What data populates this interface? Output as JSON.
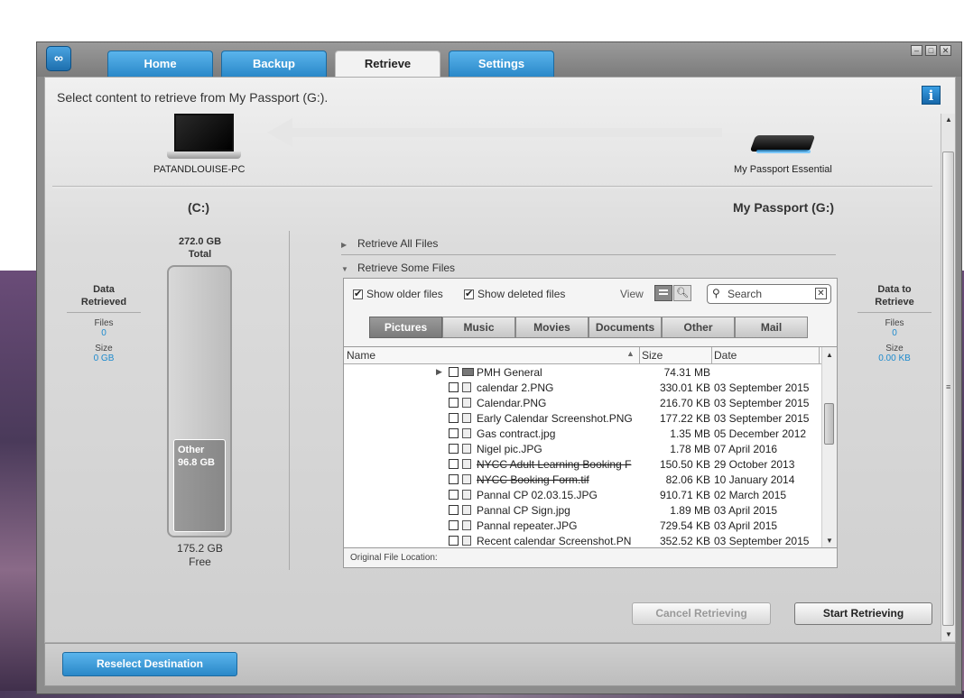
{
  "tabs": [
    {
      "label": "Home",
      "active": false
    },
    {
      "label": "Backup",
      "active": false
    },
    {
      "label": "Retrieve",
      "active": true
    },
    {
      "label": "Settings",
      "active": false
    }
  ],
  "prompt": "Select content to retrieve from My Passport (G:).",
  "source_device": {
    "name": "PATANDLOUISE-PC",
    "drive_label": "(C:)"
  },
  "dest_device": {
    "name": "My Passport Essential",
    "drive_label": "My Passport (G:)"
  },
  "capacity": {
    "total_value": "272.0 GB",
    "total_word": "Total",
    "other_label": "Other",
    "other_value": "96.8  GB",
    "other_fraction": 0.356,
    "free_value": "175.2 GB",
    "free_word": "Free"
  },
  "left_stats": {
    "head1": "Data",
    "head2": "Retrieved",
    "files_label": "Files",
    "files_value": "0",
    "size_label": "Size",
    "size_value": "0 GB"
  },
  "right_stats": {
    "head1": "Data to",
    "head2": "Retrieve",
    "files_label": "Files",
    "files_value": "0",
    "size_label": "Size",
    "size_value": "0.00 KB"
  },
  "retrieve_all": "Retrieve All Files",
  "retrieve_some": "Retrieve Some Files",
  "options": {
    "show_older": "Show older files",
    "show_deleted": "Show deleted files",
    "view_label": "View",
    "search_placeholder": "Search"
  },
  "categories": [
    {
      "label": "Pictures",
      "active": true
    },
    {
      "label": "Music",
      "active": false
    },
    {
      "label": "Movies",
      "active": false
    },
    {
      "label": "Documents",
      "active": false
    },
    {
      "label": "Other",
      "active": false
    },
    {
      "label": "Mail",
      "active": false
    }
  ],
  "columns": {
    "name": "Name",
    "size": "Size",
    "date": "Date"
  },
  "files": [
    {
      "name": "PMH General",
      "size": "74.31 MB",
      "date": "",
      "folder": true,
      "deleted": false
    },
    {
      "name": "calendar 2.PNG",
      "size": "330.01 KB",
      "date": "03 September 2015",
      "folder": false,
      "deleted": false
    },
    {
      "name": "Calendar.PNG",
      "size": "216.70 KB",
      "date": "03 September 2015",
      "folder": false,
      "deleted": false
    },
    {
      "name": "Early Calendar Screenshot.PNG",
      "size": "177.22 KB",
      "date": "03 September 2015",
      "folder": false,
      "deleted": false
    },
    {
      "name": "Gas contract.jpg",
      "size": "1.35 MB",
      "date": "05 December 2012",
      "folder": false,
      "deleted": false
    },
    {
      "name": "Nigel pic.JPG",
      "size": "1.78 MB",
      "date": "07 April 2016",
      "folder": false,
      "deleted": false
    },
    {
      "name": "NYCC Adult Learning Booking F",
      "size": "150.50 KB",
      "date": "29 October 2013",
      "folder": false,
      "deleted": true
    },
    {
      "name": "NYCC Booking Form.tif",
      "size": "82.06 KB",
      "date": "10 January 2014",
      "folder": false,
      "deleted": true
    },
    {
      "name": "Pannal CP 02.03.15.JPG",
      "size": "910.71 KB",
      "date": "02 March 2015",
      "folder": false,
      "deleted": false
    },
    {
      "name": "Pannal CP Sign.jpg",
      "size": "1.89 MB",
      "date": "03 April 2015",
      "folder": false,
      "deleted": false
    },
    {
      "name": "Pannal repeater.JPG",
      "size": "729.54 KB",
      "date": "03 April 2015",
      "folder": false,
      "deleted": false
    },
    {
      "name": "Recent calendar Screenshot.PN",
      "size": "352.52 KB",
      "date": "03 September 2015",
      "folder": false,
      "deleted": false
    }
  ],
  "original_location_label": "Original File Location:",
  "buttons": {
    "cancel": "Cancel Retrieving",
    "start": "Start Retrieving",
    "reselect": "Reselect Destination"
  },
  "colors": {
    "accent_blue": "#2a88c8",
    "stat_value": "#1d8acd"
  }
}
